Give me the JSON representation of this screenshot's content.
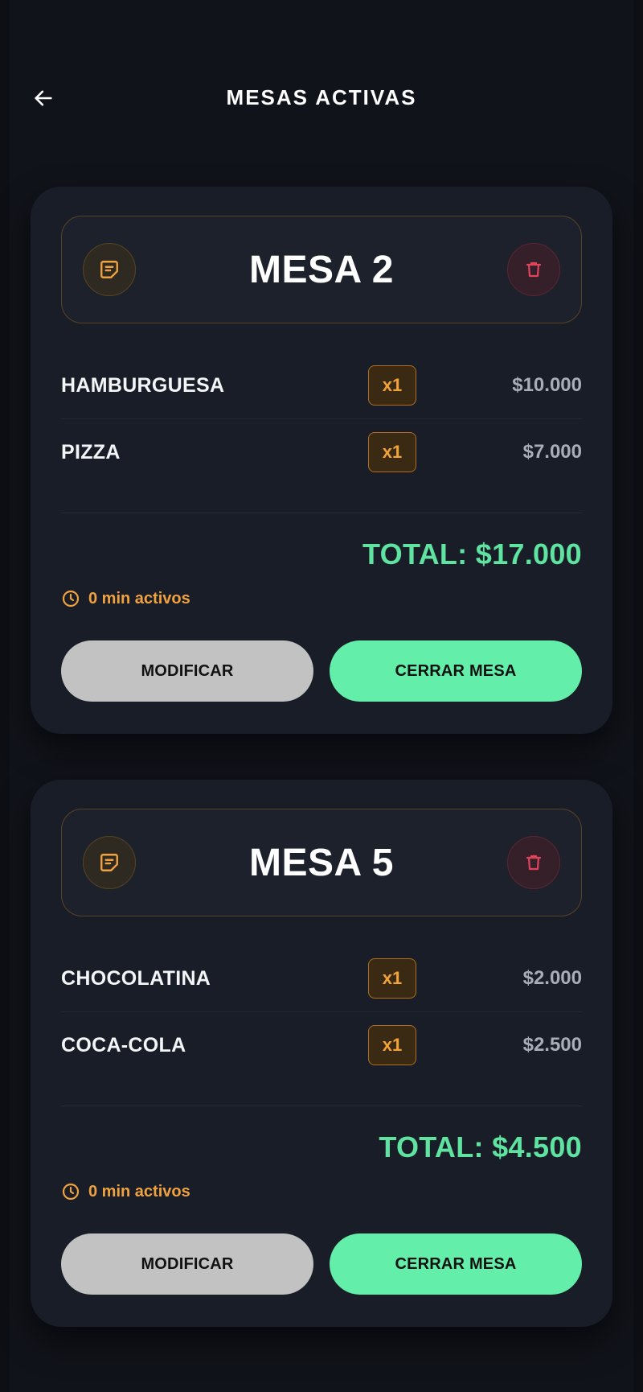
{
  "header": {
    "title": "MESAS ACTIVAS",
    "back_icon": "arrow-left-icon"
  },
  "colors": {
    "background": "#11131a",
    "card": "#191d27",
    "accent_green": "#5fe3a1",
    "accent_orange": "#f0a23f",
    "danger": "#e0435a"
  },
  "tables": [
    {
      "name": "MESA 2",
      "items": [
        {
          "name": "HAMBURGUESA",
          "qty": "x1",
          "price": "$10.000"
        },
        {
          "name": "PIZZA",
          "qty": "x1",
          "price": "$7.000"
        }
      ],
      "total": "TOTAL: $17.000",
      "time": "0 min activos",
      "modify_label": "MODIFICAR",
      "close_label": "CERRAR MESA"
    },
    {
      "name": "MESA 5",
      "items": [
        {
          "name": "CHOCOLATINA",
          "qty": "x1",
          "price": "$2.000"
        },
        {
          "name": "COCA-COLA",
          "qty": "x1",
          "price": "$2.500"
        }
      ],
      "total": "TOTAL: $4.500",
      "time": "0 min activos",
      "modify_label": "MODIFICAR",
      "close_label": "CERRAR MESA"
    }
  ]
}
